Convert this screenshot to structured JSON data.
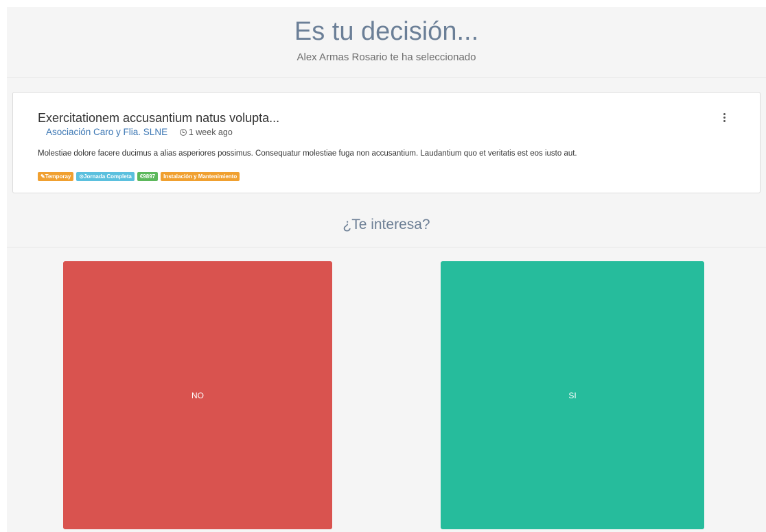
{
  "header": {
    "title": "Es tu decisión...",
    "subtitle": "Alex Armas Rosario te ha seleccionado"
  },
  "offer": {
    "title": "Exercitationem accusantium natus volupta...",
    "company": "Asociación Caro y Flia. SLNE",
    "posted": "1 week ago",
    "description": "Molestiae dolore facere ducimus a alias asperiores possimus. Consequatur molestiae fuga non accusantium. Laudantium quo et veritatis est eos iusto aut.",
    "tags": [
      {
        "label": "Temporay",
        "color": "#f0a030",
        "icon": "pencil-icon"
      },
      {
        "label": "Jornada Completa",
        "color": "#5bc0de",
        "icon": "clock-icon"
      },
      {
        "label": "€9897",
        "color": "#5cb85c",
        "icon": ""
      },
      {
        "label": "Instalación y Mantenimiento",
        "color": "#f0a030",
        "icon": ""
      }
    ]
  },
  "question": "¿Te interesa?",
  "choices": {
    "no_label": "NO",
    "yes_label": "SI",
    "no_color": "#d9534f",
    "yes_color": "#26bc9c"
  }
}
